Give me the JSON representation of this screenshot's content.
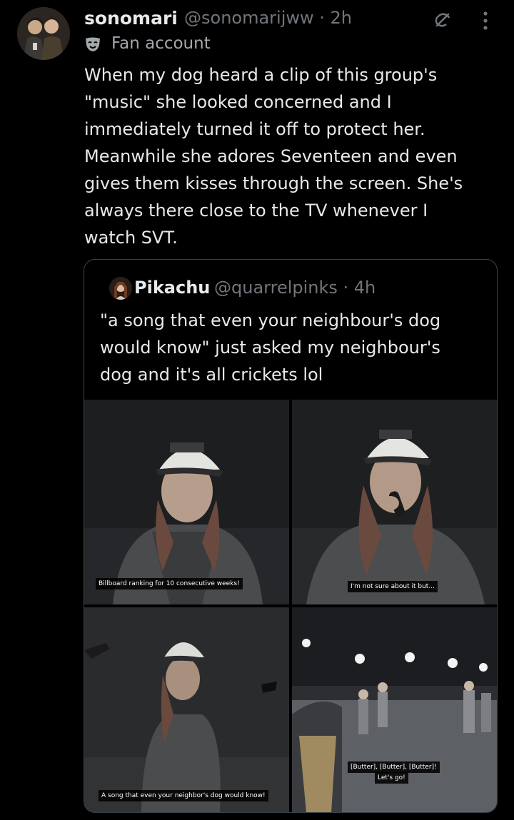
{
  "tweet": {
    "display_name": "sonomari",
    "handle_time": "@sonomarijww · 2h",
    "label": "Fan account",
    "label_icon": "mask-icon",
    "text_lines": [
      "When my dog heard a clip of this group's",
      "\"music\" she looked concerned and I",
      "immediately turned it off to protect her.",
      "Meanwhile she adores Seventeen and even",
      "gives them kisses through the screen. She's",
      "always there close to the TV whenever I",
      "watch SVT."
    ]
  },
  "quote": {
    "display_name": "Pikachu",
    "handle_time": "@quarrelpinks · 4h",
    "text_lines": [
      "\"a song that even your neighbour's dog",
      "would know\" just asked my neighbour's",
      "dog and it's all crickets lol"
    ],
    "media": {
      "captions": [
        "Billboard ranking for 10 consecutive weeks!",
        "I'm not sure about it but...",
        "A song that even your neighbor's dog would know!",
        "[Butter], [Butter], [Butter]!",
        "Let's go!"
      ]
    }
  },
  "icons": {
    "grok": "grok-icon",
    "more": "more-options-icon"
  },
  "colors": {
    "background": "#000000",
    "text": "#e7e9ea",
    "secondary": "#71767b",
    "border": "#38444d"
  }
}
